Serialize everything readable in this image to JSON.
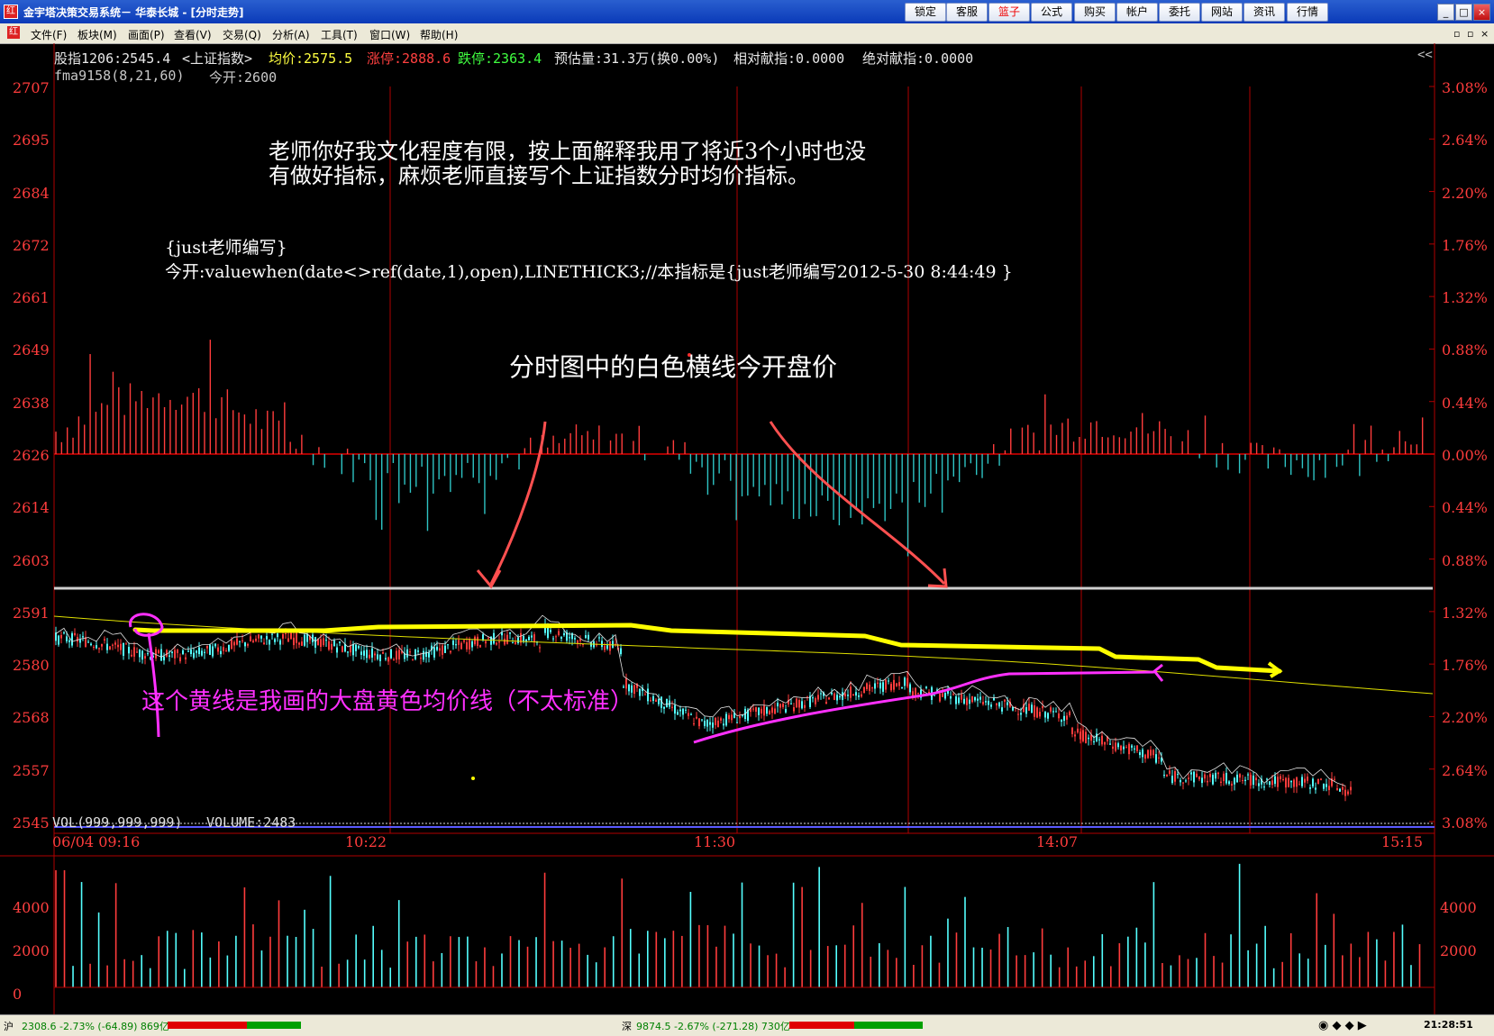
{
  "window": {
    "title": "金宇塔决策交易系统－ 华泰长城 - [分时走势]",
    "app_icon": "红",
    "toolbar_buttons": [
      "锁定",
      "客服",
      "篮子",
      "公式",
      "购买",
      "帐户",
      "委托",
      "网站",
      "资讯",
      "行情"
    ],
    "active_button": "篮子",
    "controls": [
      "_",
      "□",
      "×"
    ]
  },
  "menu": {
    "items": [
      "文件(F)",
      "板块(M)",
      "画面(P)",
      "查看(V)",
      "交易(Q)",
      "工具(T)",
      "分析(A)",
      "窗口(W)",
      "帮助(H)"
    ],
    "right_controls": [
      "▫",
      "▫",
      "×"
    ]
  },
  "quote": {
    "name": "股指1206:2545.4",
    "index": "<上证指数>",
    "avg": "均价:2575.5",
    "limit_up": "涨停:2888.6",
    "limit_down": "跌停:2363.4",
    "est_vol": "预估量:31.3万(换0.00%)",
    "rel": "相对献指:0.0000",
    "abs": "绝对献指:0.0000",
    "collapse": "<<",
    "indicator": "fma9158(8,21,60)",
    "open_today": "今开:2600"
  },
  "price_axis": {
    "left": [
      "2707",
      "2695",
      "2684",
      "2672",
      "2661",
      "2649",
      "2638",
      "2626",
      "2614",
      "2603",
      "2591",
      "2580",
      "2568",
      "2557",
      "2545"
    ],
    "right": [
      "3.08%",
      "2.64%",
      "2.20%",
      "1.76%",
      "1.32%",
      "0.88%",
      "0.44%",
      "0.00%",
      "0.44%",
      "0.88%",
      "1.32%",
      "1.76%",
      "2.20%",
      "2.64%",
      "3.08%"
    ],
    "time": [
      "06/04 09:16",
      "10:22",
      "11:30",
      "14:07",
      "15:15"
    ]
  },
  "volume": {
    "title": "VOL(999,999,999)",
    "value": "VOLUME:2483",
    "left_ticks": [
      "4000",
      "2000",
      "0"
    ],
    "right_ticks": [
      "4000",
      "2000"
    ]
  },
  "annotations": {
    "question_line1": "老师你好我文化程度有限，按上面解释我用了将近3个小时也没",
    "question_line2": "有做好指标，麻烦老师直接写个上证指数分时均价指标。",
    "formula_line1": "{just老师编写}",
    "formula_line2": "今开:valuewhen(date<>ref(date,1),open),LINETHICK3;//本指标是{just老师编写2012-5-30 8:44:49 }",
    "white_line_note": "分时图中的白色横线今开盘价",
    "yellow_line_note": "这个黄线是我画的大盘黄色均价线（不太标准）"
  },
  "status": {
    "sh": "沪",
    "sh_quote": "2308.6 -2.73% (-64.89) 869亿",
    "sz": "深",
    "sz_quote": "9874.5 -2.67% (-271.28) 730亿",
    "time": "21:28:51"
  },
  "colors": {
    "up": "#ff3c3c",
    "down": "#54ffff",
    "grid": "#b00000",
    "yellow": "#ffff00",
    "magenta": "#ff30ff",
    "coral": "#ff5050"
  }
}
